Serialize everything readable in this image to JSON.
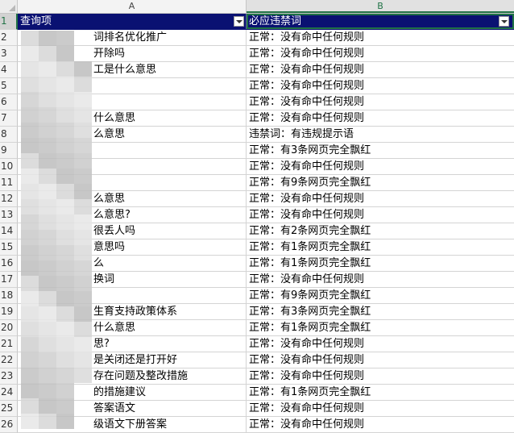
{
  "columns": [
    {
      "letter": "A"
    },
    {
      "letter": "B"
    }
  ],
  "header_row": {
    "row_number": "1",
    "col_a": "查询项",
    "col_b": "必应违禁词"
  },
  "rows": [
    {
      "n": "2",
      "a": "词排名优化推广",
      "b": "正常：没有命中任何规则"
    },
    {
      "n": "3",
      "a": "开除吗",
      "b": "正常：没有命中任何规则"
    },
    {
      "n": "4",
      "a": "工是什么意思",
      "b": "正常：没有命中任何规则"
    },
    {
      "n": "5",
      "a": "",
      "b": "正常：没有命中任何规则"
    },
    {
      "n": "6",
      "a": "",
      "b": "正常：没有命中任何规则"
    },
    {
      "n": "7",
      "a": "什么意思",
      "b": "正常：没有命中任何规则"
    },
    {
      "n": "8",
      "a": "么意思",
      "b": "违禁词：有违规提示语"
    },
    {
      "n": "9",
      "a": "",
      "b": "正常：有3条网页完全飘红"
    },
    {
      "n": "10",
      "a": "",
      "b": "正常：没有命中任何规则"
    },
    {
      "n": "11",
      "a": "",
      "b": "正常：有9条网页完全飘红"
    },
    {
      "n": "12",
      "a": "么意思",
      "b": "正常：没有命中任何规则"
    },
    {
      "n": "13",
      "a": "么意思?",
      "b": "正常：没有命中任何规则"
    },
    {
      "n": "14",
      "a": "很丢人吗",
      "b": "正常：有2条网页完全飘红"
    },
    {
      "n": "15",
      "a": "意思吗",
      "b": "正常：有1条网页完全飘红"
    },
    {
      "n": "16",
      "a": "么",
      "b": "正常：有1条网页完全飘红"
    },
    {
      "n": "17",
      "a": "换词",
      "b": "正常：没有命中任何规则"
    },
    {
      "n": "18",
      "a": "",
      "b": "正常：有9条网页完全飘红"
    },
    {
      "n": "19",
      "a": "生育支持政策体系",
      "b": "正常：有3条网页完全飘红"
    },
    {
      "n": "20",
      "a": "什么意思",
      "b": "正常：有1条网页完全飘红"
    },
    {
      "n": "21",
      "a": "思?",
      "b": "正常：没有命中任何规则"
    },
    {
      "n": "22",
      "a": "是关闭还是打开好",
      "b": "正常：没有命中任何规则"
    },
    {
      "n": "23",
      "a": "存在问题及整改措施",
      "b": "正常：没有命中任何规则"
    },
    {
      "n": "24",
      "a": "的措施建议",
      "b": "正常：有1条网页完全飘红"
    },
    {
      "n": "25",
      "a": "答案语文",
      "b": "正常：没有命中任何规则"
    },
    {
      "n": "26",
      "a": "级语文下册答案",
      "b": "正常：没有命中任何规则"
    }
  ]
}
